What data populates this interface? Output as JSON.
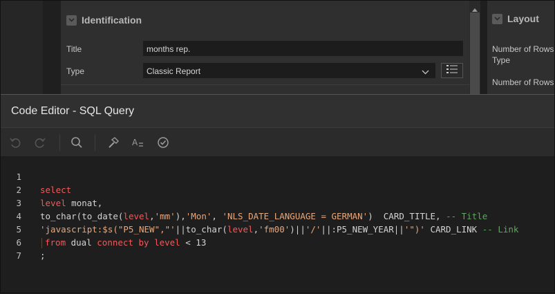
{
  "identification": {
    "section_title": "Identification",
    "title_label": "Title",
    "title_value": "months rep.",
    "type_label": "Type",
    "type_value": "Classic Report"
  },
  "layout": {
    "section_title": "Layout",
    "number_of_rows_type_line1": "Number of Rows",
    "number_of_rows_type_line2": "Type",
    "number_of_rows_label": "Number of Rows"
  },
  "dialog": {
    "title": "Code Editor - SQL Query"
  },
  "toolbar": {
    "buttons": [
      "undo-icon",
      "redo-icon",
      "search-icon",
      "hammer-icon",
      "autocomplete-icon",
      "validate-icon"
    ]
  },
  "editor": {
    "line_numbers": [
      "1",
      "2",
      "3",
      "4",
      "5",
      "6",
      "7"
    ],
    "l1": {
      "kw_select": "select"
    },
    "l2": {
      "kw_level": "level",
      "rest": " monat,"
    },
    "l3": {
      "a": "to_char(to_date(",
      "kw_level": "level",
      "b": ",",
      "s1": "'mm'",
      "c": "),",
      "s2": "'Mon'",
      "d": ", ",
      "s3": "'NLS_DATE_LANGUAGE = GERMAN'",
      "e": ")  CARD_TITLE, ",
      "cmt": "-- Title"
    },
    "l4": {
      "s1": "'javascript:$s(\"P5_NEW\",\"'",
      "a": "||to_char(",
      "kw_level": "level",
      "b": ",",
      "s2": "'fm00'",
      "c": ")||",
      "s3": "'/'",
      "d": "||:P5_NEW_YEAR||",
      "s4": "'\")'",
      "e": " CARD_LINK ",
      "cmt": "-- Link"
    },
    "l5": {
      "kw_from": "from",
      "a": " dual ",
      "kw_connect": "connect",
      "sp1": " ",
      "kw_by": "by",
      "sp2": " ",
      "kw_level": "level",
      "b": " < 13"
    },
    "l6": {
      "a": ";"
    },
    "l7": {
      "a": ""
    }
  }
}
